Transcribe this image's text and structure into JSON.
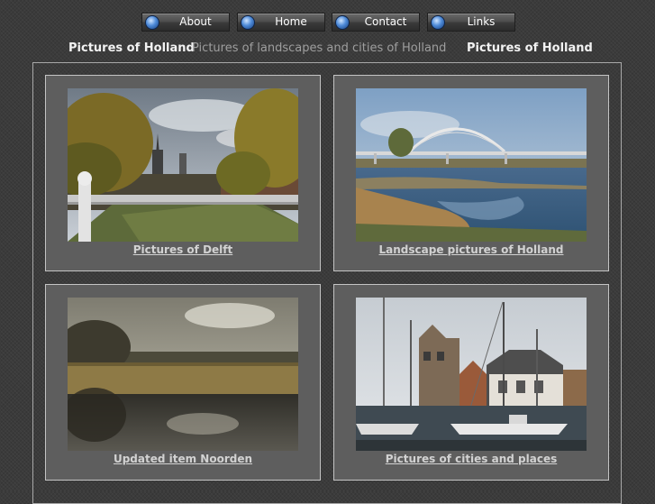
{
  "nav": {
    "items": [
      {
        "label": "About"
      },
      {
        "label": "Home"
      },
      {
        "label": "Contact"
      },
      {
        "label": "Links"
      }
    ]
  },
  "header": {
    "site_title": "Pictures of Holland",
    "tagline": "Pictures of landscapes and cities of Holland",
    "site_title_right": "Pictures of Holland"
  },
  "cards": [
    {
      "caption": "Pictures of Delft",
      "image": "delft-canal-photo"
    },
    {
      "caption": "Landscape pictures of Holland",
      "image": "river-bridge-photo"
    },
    {
      "caption": "Updated item Noorden",
      "image": "reed-lake-photo"
    },
    {
      "caption": "Pictures of cities and places",
      "image": "harbour-town-photo"
    }
  ]
}
